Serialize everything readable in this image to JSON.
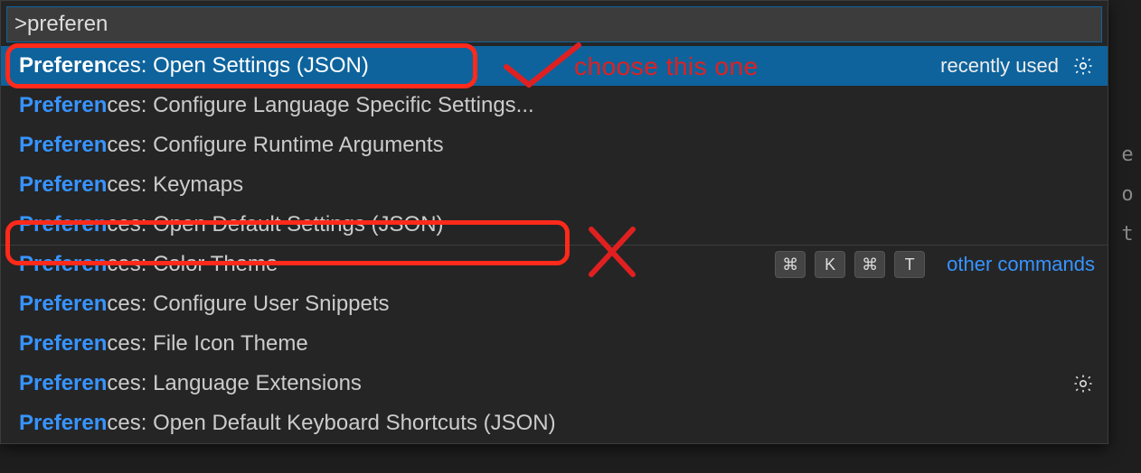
{
  "search": {
    "value": ">preferen"
  },
  "match_prefix": "Preferen",
  "rows": [
    {
      "rest": "ces: Open Settings (JSON)",
      "selected": true,
      "gear": true,
      "recently_used": "recently used"
    },
    {
      "rest": "ces: Configure Language Specific Settings..."
    },
    {
      "rest": "ces: Configure Runtime Arguments"
    },
    {
      "rest": "ces: Keymaps"
    },
    {
      "rest": "ces: Open Default Settings (JSON)"
    },
    {
      "rest": "ces: Color Theme",
      "separator_above": true,
      "keys": [
        "⌘",
        "K",
        "⌘",
        "T"
      ],
      "other_commands": "other commands"
    },
    {
      "rest": "ces: Configure User Snippets"
    },
    {
      "rest": "ces: File Icon Theme"
    },
    {
      "rest": "ces: Language Extensions",
      "gear": true
    },
    {
      "rest": "ces: Open Default Keyboard Shortcuts (JSON)"
    }
  ],
  "gutter": [
    "e",
    "o",
    "t"
  ],
  "annotation": {
    "label": "choose this one"
  }
}
